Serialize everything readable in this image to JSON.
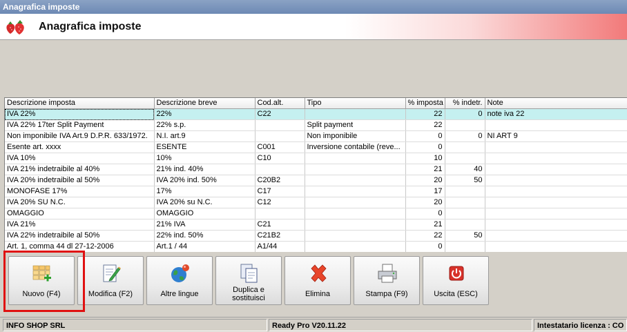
{
  "window": {
    "title": "Anagrafica imposte"
  },
  "header": {
    "title": "Anagrafica imposte",
    "logo_icon": "strawberry-icon"
  },
  "grid": {
    "columns": [
      "Descrizione imposta",
      "Descrizione breve",
      "Cod.alt.",
      "Tipo",
      "% imposta",
      "% indetr.",
      "Note"
    ],
    "rows": [
      [
        "IVA 22%",
        "22%",
        "C22",
        "",
        "22",
        "0",
        "note iva 22"
      ],
      [
        "IVA 22% 17ter Split Payment",
        "22% s.p.",
        "",
        "Split payment",
        "22",
        "",
        ""
      ],
      [
        "Non imponibile IVA Art.9 D.P.R. 633/1972.",
        "N.I. art.9",
        "",
        "Non imponibile",
        "0",
        "0",
        "NI ART 9"
      ],
      [
        "Esente art. xxxx",
        "ESENTE",
        "C001",
        "Inversione contabile (reve...",
        "0",
        "",
        ""
      ],
      [
        "IVA 10%",
        "10%",
        "C10",
        "",
        "10",
        "",
        ""
      ],
      [
        "IVA 21% indetraibile al 40%",
        "21% ind. 40%",
        "",
        "",
        "21",
        "40",
        ""
      ],
      [
        "IVA 20% indetraibile al 50%",
        "IVA 20% ind. 50%",
        "C20B2",
        "",
        "20",
        "50",
        ""
      ],
      [
        "MONOFASE 17%",
        "17%",
        "C17",
        "",
        "17",
        "",
        ""
      ],
      [
        "IVA 20% SU N.C.",
        "IVA 20% su N.C.",
        "C12",
        "",
        "20",
        "",
        ""
      ],
      [
        "OMAGGIO",
        "OMAGGIO",
        "",
        "",
        "0",
        "",
        ""
      ],
      [
        "IVA 21%",
        "21% IVA",
        "C21",
        "",
        "21",
        "",
        ""
      ],
      [
        "IVA 22% indetraibile al 50%",
        "22% ind. 50%",
        "C21B2",
        "",
        "22",
        "50",
        ""
      ],
      [
        "Art. 1, comma 44 dl 27-12-2006",
        "Art.1 / 44",
        "A1/44",
        "",
        "0",
        "",
        ""
      ]
    ],
    "selected_row": 0
  },
  "toolbar": {
    "buttons": [
      {
        "label": "Nuovo (F4)",
        "icon": "new-grid-icon"
      },
      {
        "label": "Modifica (F2)",
        "icon": "edit-document-icon"
      },
      {
        "label": "Altre lingue",
        "icon": "globe-icon"
      },
      {
        "label": "Duplica e sostituisci",
        "icon": "duplicate-icon"
      },
      {
        "label": "Elimina",
        "icon": "delete-x-icon"
      },
      {
        "label": "Stampa (F9)",
        "icon": "printer-icon"
      },
      {
        "label": "Uscita (ESC)",
        "icon": "exit-icon"
      }
    ]
  },
  "status": {
    "company": "INFO SHOP SRL",
    "version": "Ready Pro V20.11.22",
    "license": "Intestatario licenza : CO"
  }
}
